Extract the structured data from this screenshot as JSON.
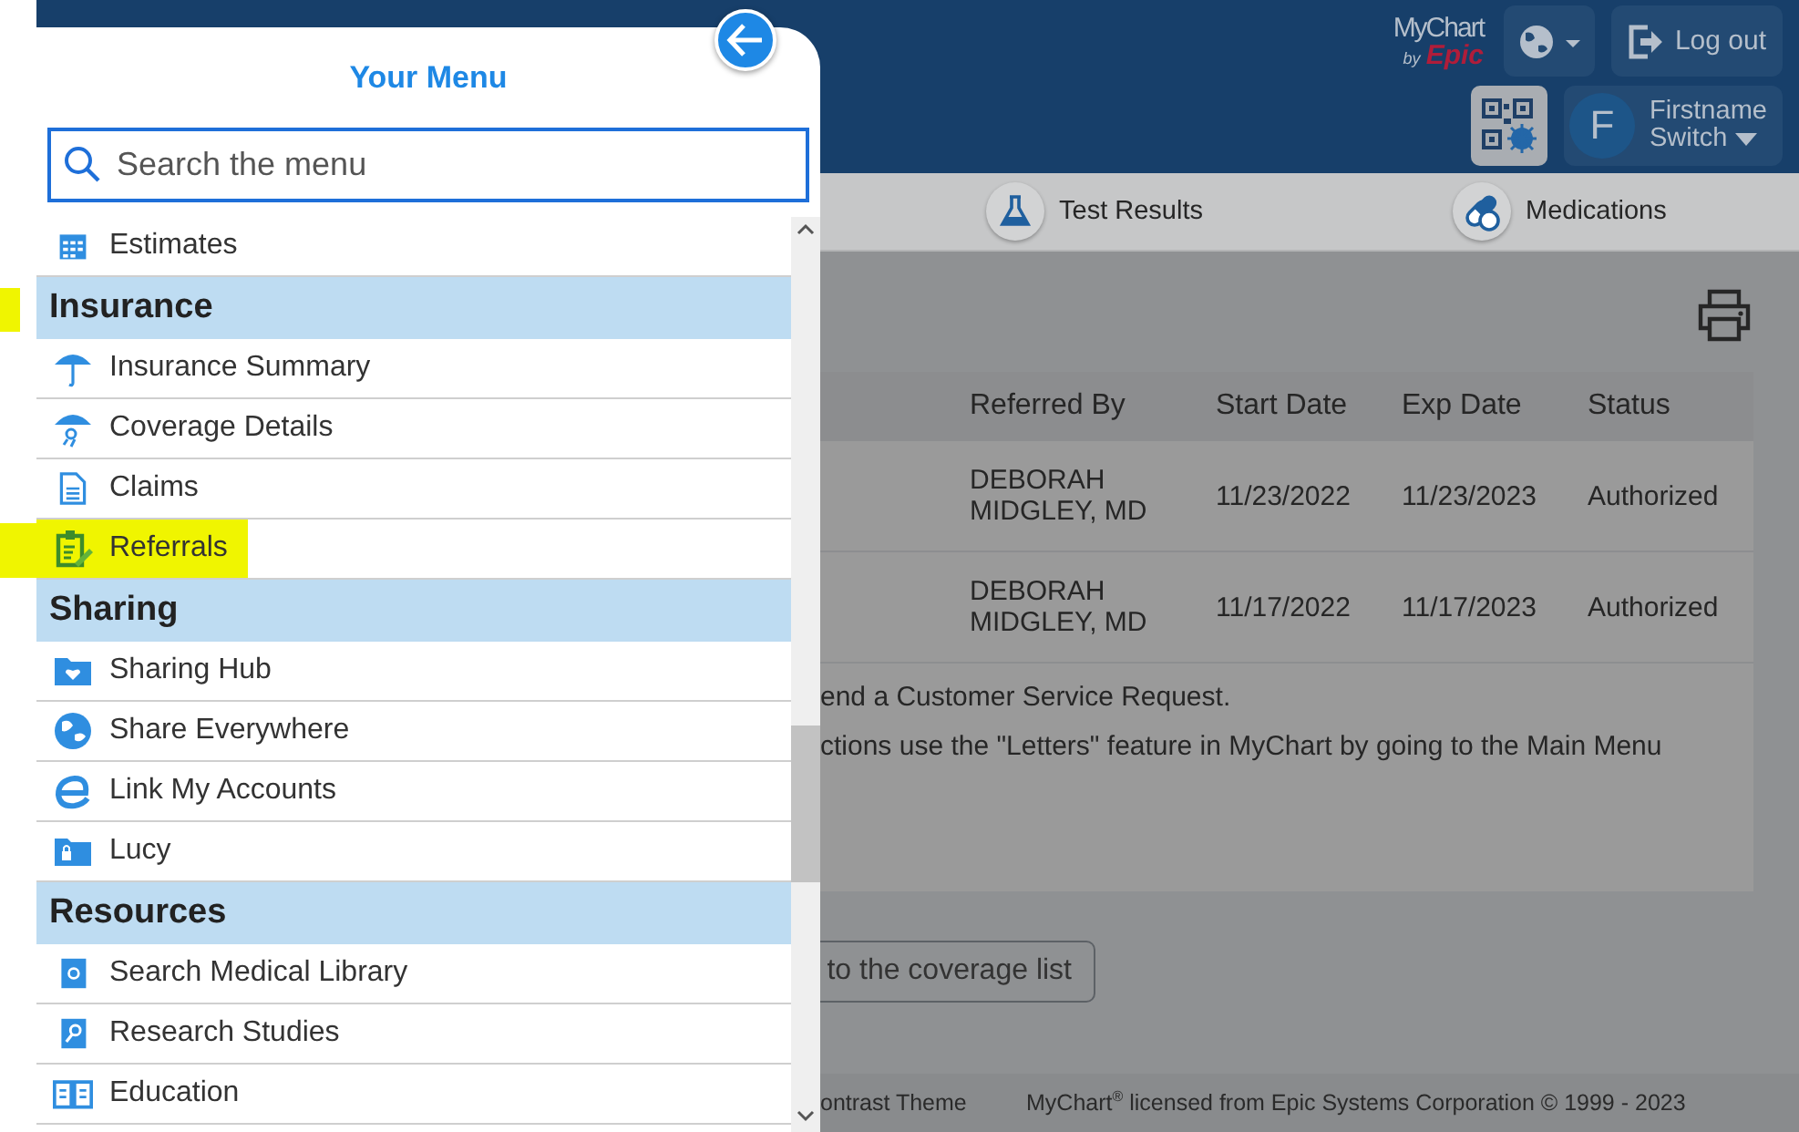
{
  "menu": {
    "title": "Your Menu",
    "search": {
      "placeholder": "Search the menu"
    },
    "rows": [
      {
        "kind": "item",
        "label": "Estimates",
        "highlighted": false
      },
      {
        "kind": "heading",
        "label": "Insurance",
        "highlighted": true
      },
      {
        "kind": "item",
        "label": "Insurance Summary",
        "highlighted": false
      },
      {
        "kind": "item",
        "label": "Coverage Details",
        "highlighted": false
      },
      {
        "kind": "item",
        "label": "Claims",
        "highlighted": false
      },
      {
        "kind": "item",
        "label": "Referrals",
        "highlighted": true
      },
      {
        "kind": "heading",
        "label": "Sharing",
        "highlighted": false
      },
      {
        "kind": "item",
        "label": "Sharing Hub",
        "highlighted": false
      },
      {
        "kind": "item",
        "label": "Share Everywhere",
        "highlighted": false
      },
      {
        "kind": "item",
        "label": "Link My Accounts",
        "highlighted": false
      },
      {
        "kind": "item",
        "label": "Lucy",
        "highlighted": false
      },
      {
        "kind": "heading",
        "label": "Resources",
        "highlighted": false
      },
      {
        "kind": "item",
        "label": "Search Medical Library",
        "highlighted": false
      },
      {
        "kind": "item",
        "label": "Research Studies",
        "highlighted": false
      },
      {
        "kind": "item",
        "label": "Education",
        "highlighted": false
      }
    ]
  },
  "header": {
    "logo": {
      "name": "MyChart",
      "by": "by",
      "brand": "Epic"
    },
    "logout": "Log out",
    "profile": {
      "initial": "F",
      "name": "Firstname",
      "switch": "Switch"
    }
  },
  "nav": [
    {
      "label": "Test Results"
    },
    {
      "label": "Medications"
    }
  ],
  "table": {
    "columns": [
      "Referred By",
      "Start Date",
      "Exp Date",
      "Status"
    ],
    "rows": [
      [
        "DEBORAH MIDGLEY, MD",
        "11/23/2022",
        "11/23/2023",
        "Authorized"
      ],
      [
        "DEBORAH MIDGLEY, MD",
        "11/17/2022",
        "11/17/2023",
        "Authorized"
      ]
    ],
    "notes": [
      "end a Customer Service Request.",
      "ctions use the \"Letters\" feature in MyChart by going to the Main Menu"
    ]
  },
  "back_button": "to the coverage list",
  "footer": [
    "ontrast Theme",
    "MyChart$^{®}$ licensed from Epic Systems Corporation © 1999 - 2023"
  ]
}
